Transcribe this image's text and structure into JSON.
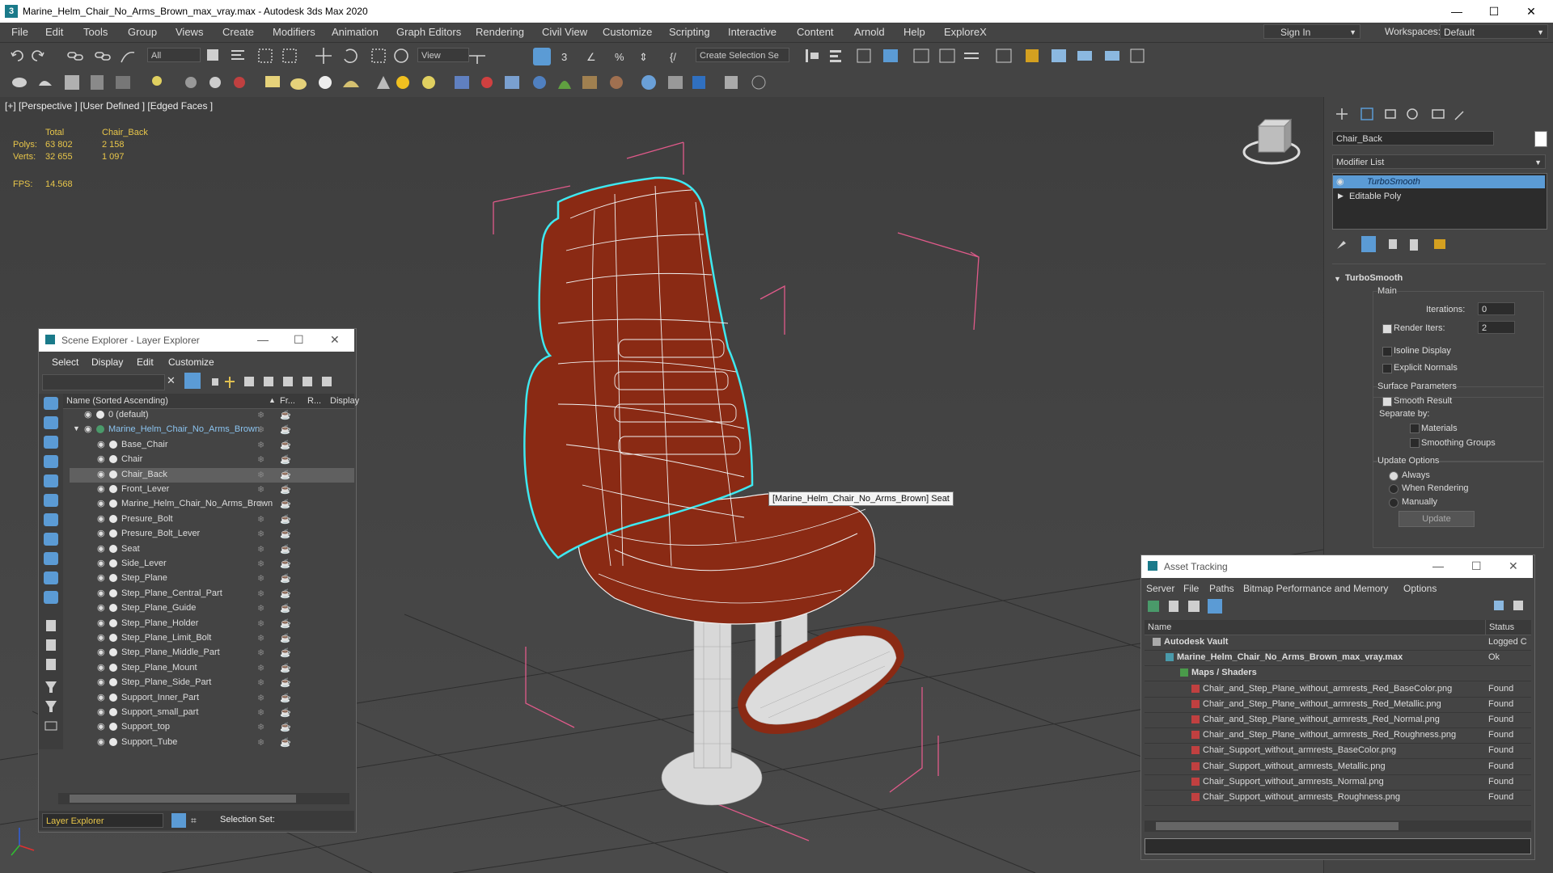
{
  "window": {
    "title": "Marine_Helm_Chair_No_Arms_Brown_max_vray.max - Autodesk 3ds Max 2020",
    "min": "—",
    "max": "☐",
    "close": "✕"
  },
  "menu": [
    "File",
    "Edit",
    "Tools",
    "Group",
    "Views",
    "Create",
    "Modifiers",
    "Animation",
    "Graph Editors",
    "Rendering",
    "Civil View",
    "Customize",
    "Scripting",
    "Interactive",
    "Content",
    "Arnold",
    "Help",
    "ExploreX"
  ],
  "signin": "Sign In",
  "workspaces_label": "Workspaces:",
  "workspace_value": "Default",
  "toolbar": {
    "filter": "All",
    "refcoord": "View",
    "selection_set": "Create Selection Se"
  },
  "viewport": {
    "label": "[+] [Perspective ] [User Defined ] [Edged Faces ]",
    "stats": {
      "total_header": "Total",
      "object_header": "Chair_Back",
      "polys_label": "Polys:",
      "polys_total": "63 802",
      "polys_obj": "2 158",
      "verts_label": "Verts:",
      "verts_total": "32 655",
      "verts_obj": "1 097",
      "fps_label": "FPS:",
      "fps_value": "14.568"
    },
    "tooltip": "[Marine_Helm_Chair_No_Arms_Brown] Seat"
  },
  "command_panel": {
    "object_name": "Chair_Back",
    "modifier_list": "Modifier List",
    "stack": [
      "TurboSmooth",
      "Editable Poly"
    ],
    "rollout_title": "TurboSmooth",
    "main_group": "Main",
    "iterations_label": "Iterations:",
    "iterations_value": "0",
    "render_iters_label": "Render Iters:",
    "render_iters_value": "2",
    "isoline": "Isoline Display",
    "explicit_normals": "Explicit Normals",
    "surface_group": "Surface Parameters",
    "smooth_result": "Smooth Result",
    "separate_by": "Separate by:",
    "materials": "Materials",
    "smoothing_groups": "Smoothing Groups",
    "update_group": "Update Options",
    "always": "Always",
    "when_rendering": "When Rendering",
    "manually": "Manually",
    "update_button": "Update"
  },
  "scene_explorer": {
    "title": "Scene Explorer - Layer Explorer",
    "menu": [
      "Select",
      "Display",
      "Edit",
      "Customize"
    ],
    "col_name": "Name (Sorted Ascending)",
    "col_fr": "Fr...",
    "col_r": "R...",
    "col_display": "Display",
    "rows": [
      {
        "name": "0 (default)",
        "level": 1
      },
      {
        "name": "Marine_Helm_Chair_No_Arms_Brown",
        "level": 1
      },
      {
        "name": "Base_Chair",
        "level": 2
      },
      {
        "name": "Chair",
        "level": 2
      },
      {
        "name": "Chair_Back",
        "level": 2
      },
      {
        "name": "Front_Lever",
        "level": 2
      },
      {
        "name": "Marine_Helm_Chair_No_Arms_Brown",
        "level": 2
      },
      {
        "name": "Presure_Bolt",
        "level": 2
      },
      {
        "name": "Presure_Bolt_Lever",
        "level": 2
      },
      {
        "name": "Seat",
        "level": 2
      },
      {
        "name": "Side_Lever",
        "level": 2
      },
      {
        "name": "Step_Plane",
        "level": 2
      },
      {
        "name": "Step_Plane_Central_Part",
        "level": 2
      },
      {
        "name": "Step_Plane_Guide",
        "level": 2
      },
      {
        "name": "Step_Plane_Holder",
        "level": 2
      },
      {
        "name": "Step_Plane_Limit_Bolt",
        "level": 2
      },
      {
        "name": "Step_Plane_Middle_Part",
        "level": 2
      },
      {
        "name": "Step_Plane_Mount",
        "level": 2
      },
      {
        "name": "Step_Plane_Side_Part",
        "level": 2
      },
      {
        "name": "Support_Inner_Part",
        "level": 2
      },
      {
        "name": "Support_small_part",
        "level": 2
      },
      {
        "name": "Support_top",
        "level": 2
      },
      {
        "name": "Support_Tube",
        "level": 2
      }
    ],
    "selected_row": "Chair_Back",
    "footer_mode": "Layer Explorer",
    "selection_set_label": "Selection Set:"
  },
  "asset_tracking": {
    "title": "Asset Tracking",
    "menu": [
      "Server",
      "File",
      "Paths",
      "Bitmap Performance and Memory",
      "Options"
    ],
    "col_name": "Name",
    "col_status": "Status",
    "rows": [
      {
        "name": "Autodesk Vault",
        "status": "Logged C"
      },
      {
        "name": "Marine_Helm_Chair_No_Arms_Brown_max_vray.max",
        "status": "Ok"
      },
      {
        "name": "Maps / Shaders",
        "status": ""
      },
      {
        "name": "Chair_and_Step_Plane_without_armrests_Red_BaseColor.png",
        "status": "Found"
      },
      {
        "name": "Chair_and_Step_Plane_without_armrests_Red_Metallic.png",
        "status": "Found"
      },
      {
        "name": "Chair_and_Step_Plane_without_armrests_Red_Normal.png",
        "status": "Found"
      },
      {
        "name": "Chair_and_Step_Plane_without_armrests_Red_Roughness.png",
        "status": "Found"
      },
      {
        "name": "Chair_Support_without_armrests_BaseColor.png",
        "status": "Found"
      },
      {
        "name": "Chair_Support_without_armrests_Metallic.png",
        "status": "Found"
      },
      {
        "name": "Chair_Support_without_armrests_Normal.png",
        "status": "Found"
      },
      {
        "name": "Chair_Support_without_armrests_Roughness.png",
        "status": "Found"
      }
    ]
  },
  "colors": {
    "accent_blue": "#5b9bd5",
    "stats_yellow": "#e8c64a",
    "seat_red": "#8a2a14",
    "wire_white": "#f0f0f0",
    "selection_cyan": "#3ee8f0",
    "bbox_pink": "#e05a8a"
  }
}
